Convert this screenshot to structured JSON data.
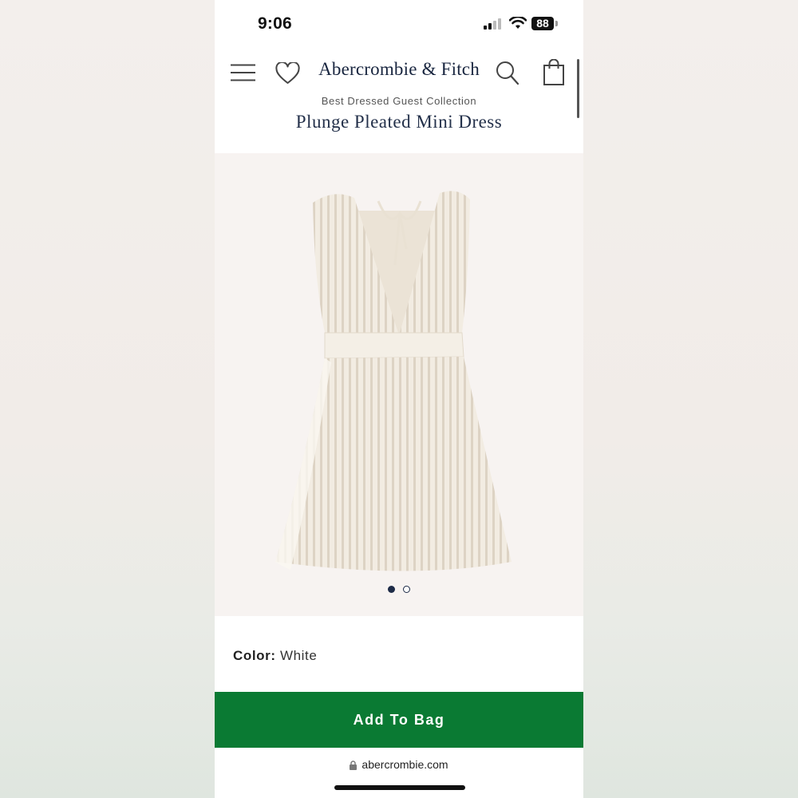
{
  "status_bar": {
    "time": "9:06",
    "battery": "88"
  },
  "header": {
    "logo": "Abercrombie & Fitch",
    "collection": "Best Dressed Guest Collection",
    "product_title": "Plunge Pleated Mini Dress",
    "icons": [
      "menu-icon",
      "heart-icon",
      "search-icon",
      "bag-icon"
    ]
  },
  "gallery": {
    "total_images": 2,
    "active_index": 1
  },
  "product": {
    "color_label": "Color:",
    "color_value": "White"
  },
  "actions": {
    "add_to_bag": "Add To Bag"
  },
  "browser": {
    "url": "abercrombie.com"
  },
  "colors": {
    "brand_navy": "#18253f",
    "add_button_green": "#0a7a33",
    "dress_cream": "#f1ebe0"
  }
}
